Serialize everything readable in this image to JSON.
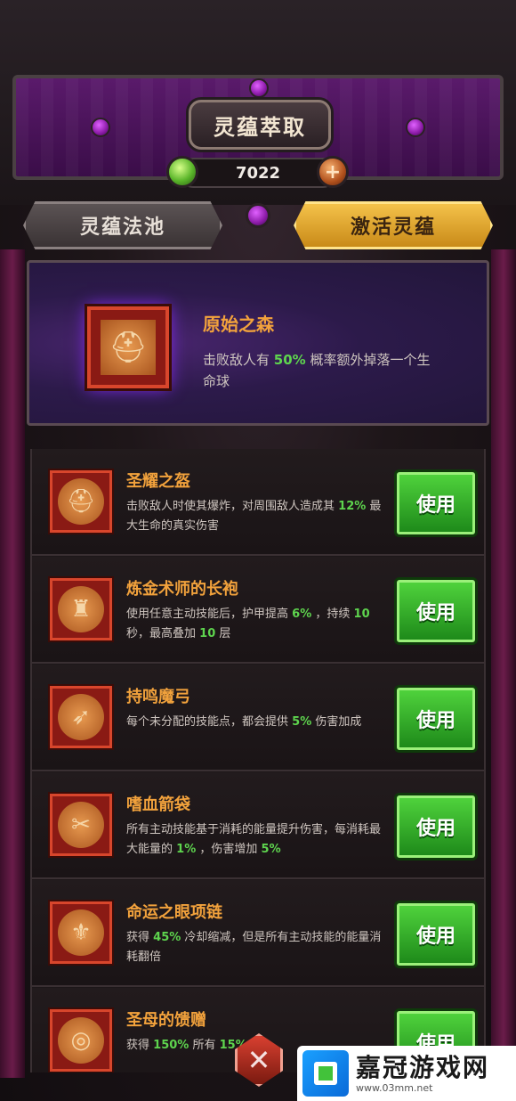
{
  "header": {
    "title": "灵蕴萃取",
    "currency_value": "7022",
    "plus_symbol": "+"
  },
  "tabs": [
    {
      "label": "灵蕴法池",
      "active": false
    },
    {
      "label": "激活灵蕴",
      "active": true
    }
  ],
  "featured": {
    "name": "原始之森",
    "desc_before": "击败敌人有",
    "highlight": "50%",
    "desc_after": "概率额外掉落一个生命球",
    "icon": "helmet-icon"
  },
  "items": [
    {
      "name": "圣耀之盔",
      "icon": "helmet-icon",
      "desc_a": "击败敌人时使其爆炸，对周围敌人造成其",
      "hl1": "12%",
      "desc_b": "最大生命的真实伤害",
      "hl2": "",
      "desc_c": "",
      "hl3": "",
      "desc_d": "",
      "button": "使用"
    },
    {
      "name": "炼金术师的长袍",
      "icon": "robe-icon",
      "desc_a": "使用任意主动技能后，护甲提高",
      "hl1": "6%",
      "desc_b": "，持续",
      "hl2": "10",
      "desc_c": "秒，最高叠加",
      "hl3": "10",
      "desc_d": "层",
      "button": "使用"
    },
    {
      "name": "持鸣魔弓",
      "icon": "bow-icon",
      "desc_a": "每个未分配的技能点，都会提供",
      "hl1": "5%",
      "desc_b": "伤害加成",
      "hl2": "",
      "desc_c": "",
      "hl3": "",
      "desc_d": "",
      "button": "使用"
    },
    {
      "name": "嗜血箭袋",
      "icon": "quiver-icon",
      "desc_a": "所有主动技能基于消耗的能量提升伤害，每消耗最大能量的",
      "hl1": "1%",
      "desc_b": "，伤害增加",
      "hl2": "5%",
      "desc_c": "",
      "hl3": "",
      "desc_d": "",
      "button": "使用"
    },
    {
      "name": "命运之眼项链",
      "icon": "amulet-icon",
      "desc_a": "获得",
      "hl1": "45%",
      "desc_b": "冷却缩减，但是所有主动技能的能量消耗翻倍",
      "hl2": "",
      "desc_c": "",
      "hl3": "",
      "desc_d": "",
      "button": "使用"
    },
    {
      "name": "圣母的馈赠",
      "icon": "ring-icon",
      "desc_a": "获得",
      "hl1": "150%",
      "desc_b": "所有",
      "hl2": "15%",
      "desc_c": "",
      "hl3": "",
      "desc_d": "",
      "button": "使用"
    }
  ],
  "bottom_button": "✕",
  "watermark": {
    "title": "嘉冠游戏网",
    "url": "www.03mm.net"
  }
}
